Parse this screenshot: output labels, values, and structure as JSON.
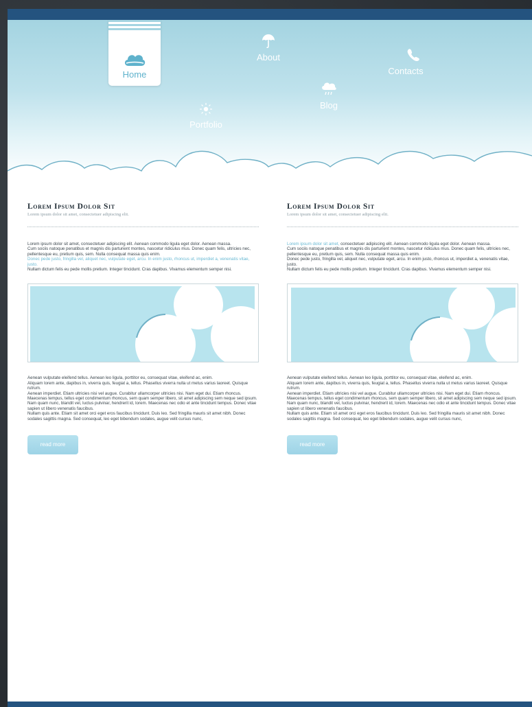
{
  "nav": {
    "home": {
      "label": "Home",
      "icon": "cloud-icon"
    },
    "about": {
      "label": "About",
      "icon": "umbrella-icon"
    },
    "contacts": {
      "label": "Contacts",
      "icon": "phone-icon"
    },
    "blog": {
      "label": "Blog",
      "icon": "cloud-rain-icon"
    },
    "portfolio": {
      "label": "Portfolio",
      "icon": "sun-icon"
    }
  },
  "colors": {
    "accent": "#24537f",
    "sky": "#a4d4e1",
    "highlight": "#69b9d3",
    "button": "#9dd3e6"
  },
  "posts": [
    {
      "title": "Lorem Ipsum Dolor Sit",
      "subtitle": "Lorem ipsum dolor sit amet, consectetuer adipiscing elit.",
      "intro": [
        {
          "text": "Lorem ipsum dolor sit amet, consectetuer adipiscing elit. Aenean commodo ligula eget dolor. Aenean massa."
        },
        {
          "text": "Cum sociis natoque penatibus et magnis dis parturient montes, nascetur ridiculus mus. Donec quam felis, ultricies nec, pellentesque eu, pretium quis, sem. Nulla consequat massa quis enim."
        },
        {
          "text": "Donec pede justo, fringilla vel, aliquet nec, vulputate eget, arcu. In enim justo, rhoncus ut, imperdiet a, venenatis vitae, justo."
        },
        {
          "text": "Nullam dictum felis eu pede mollis pretium. Integer tincidunt. Cras dapibus. Vivamus elementum semper nisi."
        }
      ],
      "details": [
        "Aenean vulputate eleifend tellus. Aenean leo ligula, porttitor eu, consequat vitae, eleifend ac, enim.",
        "Aliquam lorem ante, dapibus in, viverra quis, feugiat a, tellus. Phasellus viverra nulla ut metus varius laoreet. Quisque rutrum.",
        "Aenean imperdiet. Etiam ultricies nisi vel augue. Curabitur ullamcorper ultricies nisi. Nam eget dui. Etiam rhoncus.",
        "Maecenas tempus, tellus eget condimentum rhoncus, sem quam semper libero, sit amet adipiscing sem neque sed ipsum.",
        "Nam quam nunc, blandit vel, luctus pulvinar, hendrerit id, lorem. Maecenas nec odio et ante tincidunt tempus. Donec vitae sapien ut libero venenatis faucibus.",
        "Nullam quis ante. Etiam sit amet orci eget eros faucibus tincidunt. Duis leo. Sed fringilla mauris sit amet nibh. Donec sodales sagittis magna. Sed consequat, leo eget bibendum sodales, augue velit cursus nunc,"
      ],
      "button": "read more"
    },
    {
      "title": "Lorem Ipsum Dolor Sit",
      "subtitle": "Lorem ipsum dolor sit amet, consectetuer adipiscing elit.",
      "intro": [
        {
          "text": "Lorem ipsum dolor sit amet, consectetuer adipiscing elit. Aenean commodo ligula eget dolor. Aenean massa."
        },
        {
          "text": "Cum sociis natoque penatibus et magnis dis parturient montes, nascetur ridiculus mus. Donec quam felis, ultricies nec, pellentesque eu, pretium quis, sem. Nulla consequat massa quis enim."
        },
        {
          "text": "Donec pede justo, fringilla vel, aliquet nec, vulputate eget, arcu. In enim justo, rhoncus ut, imperdiet a, venenatis vitae, justo."
        },
        {
          "text": "Nullam dictum felis eu pede mollis pretium. Integer tincidunt. Cras dapibus. Vivamus elementum semper nisi."
        }
      ],
      "details": [
        "Aenean vulputate eleifend tellus. Aenean leo ligula, porttitor eu, consequat vitae, eleifend ac, enim.",
        "Aliquam lorem ante, dapibus in, viverra quis, feugiat a, tellus. Phasellus viverra nulla ut metus varius laoreet. Quisque rutrum.",
        "Aenean imperdiet. Etiam ultricies nisi vel augue. Curabitur ullamcorper ultricies nisi. Nam eget dui. Etiam rhoncus.",
        "Maecenas tempus, tellus eget condimentum rhoncus, sem quam semper libero, sit amet adipiscing sem neque sed ipsum.",
        "Nam quam nunc, blandit vel, luctus pulvinar, hendrerit id, lorem. Maecenas nec odio et ante tincidunt tempus. Donec vitae sapien ut libero venenatis faucibus.",
        "Nullam quis ante. Etiam sit amet orci eget eros faucibus tincidunt. Duis leo. Sed fringilla mauris sit amet nibh. Donec sodales sagittis magna. Sed consequat, leo eget bibendum sodales, augue velit cursus nunc,"
      ],
      "button": "read more"
    }
  ]
}
